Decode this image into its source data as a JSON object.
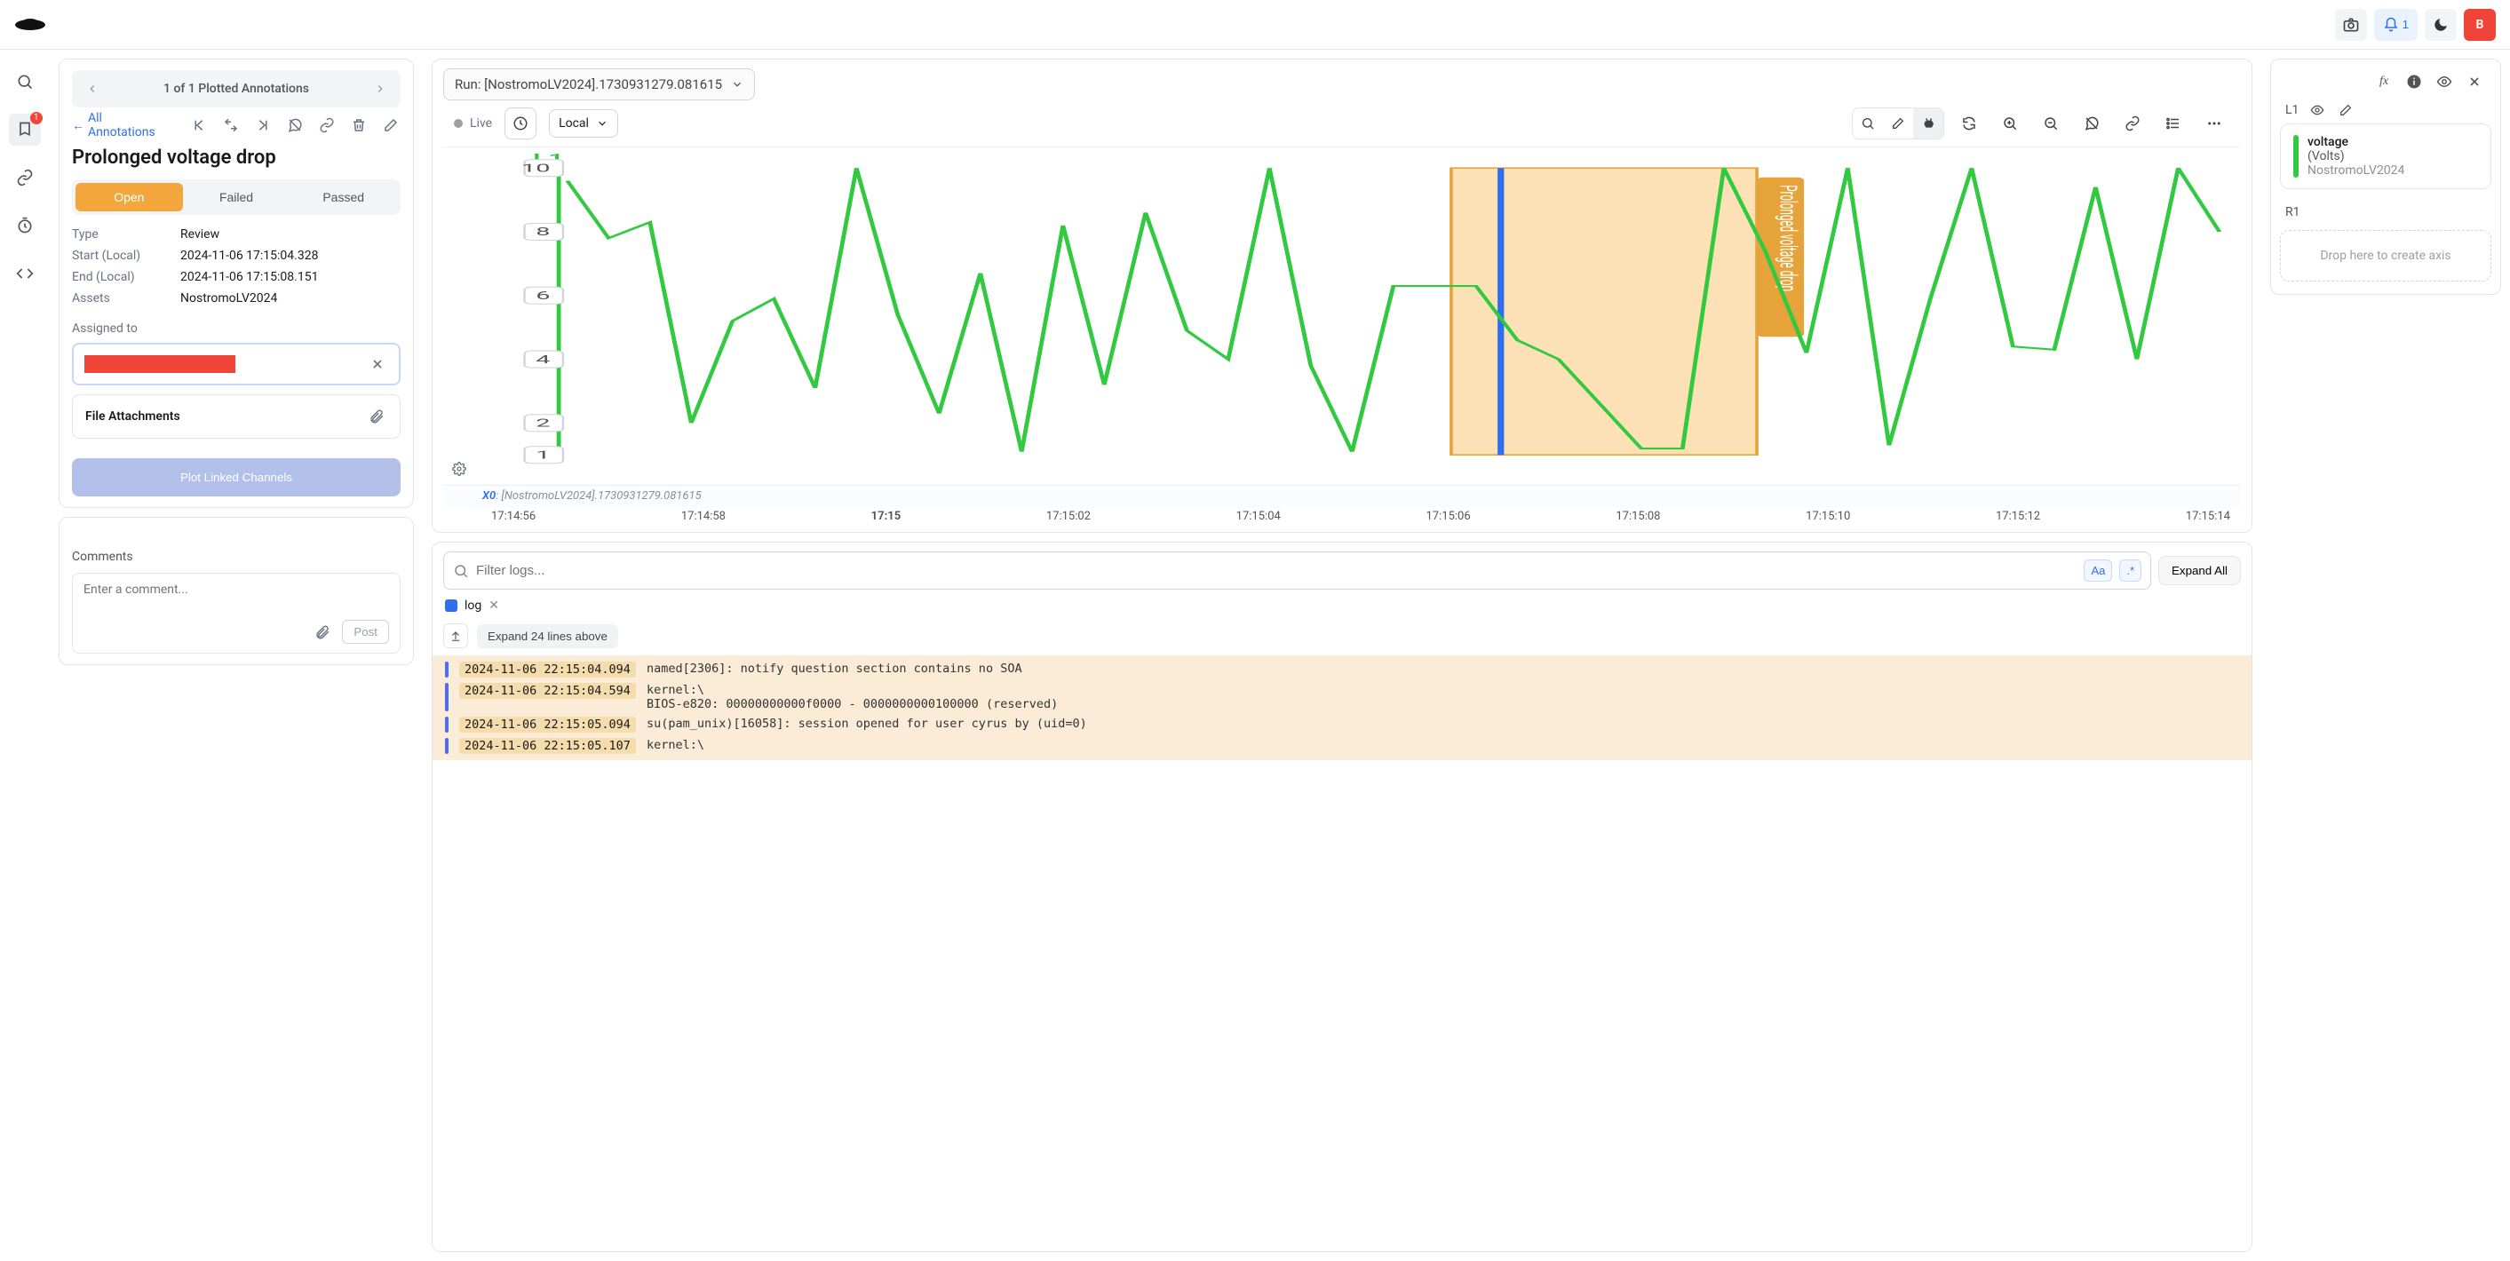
{
  "topbar": {
    "notif_count": "1",
    "avatar_initial": "B"
  },
  "railnav": {
    "badge": "1"
  },
  "left": {
    "pager_text": "1 of 1 Plotted Annotations",
    "back_link": "All Annotations",
    "title": "Prolonged voltage drop",
    "status": {
      "open": "Open",
      "failed": "Failed",
      "passed": "Passed"
    },
    "meta": {
      "type_k": "Type",
      "type_v": "Review",
      "start_k": "Start (Local)",
      "start_v": "2024-11-06 17:15:04.328",
      "end_k": "End (Local)",
      "end_v": "2024-11-06 17:15:08.151",
      "assets_k": "Assets",
      "assets_v": "NostromoLV2024"
    },
    "assigned_label": "Assigned to",
    "attachments_label": "File Attachments",
    "plot_btn": "Plot Linked Channels",
    "comments_label": "Comments",
    "comment_placeholder": "Enter a comment...",
    "post_btn": "Post"
  },
  "center": {
    "run_label": "Run: [NostromoLV2024].1730931279.081615",
    "live_label": "Live",
    "tz_label": "Local",
    "l1_label": "L1",
    "x0_label": "X0",
    "x0_run": ": [NostromoLV2024].1730931279.081615",
    "annotation_label": "Prolonged voltage drop",
    "xaxis_ticks": [
      "17:14:56",
      "17:14:58",
      "17:15",
      "17:15:02",
      "17:15:04",
      "17:15:06",
      "17:15:08",
      "17:15:10",
      "17:15:12",
      "17:15:14"
    ],
    "xaxis_bold_index": 2,
    "yticks": [
      "1",
      "2",
      "4",
      "6",
      "8",
      "10"
    ]
  },
  "chart_data": {
    "type": "line",
    "title": "",
    "xlabel": "",
    "ylabel": "",
    "ylim": [
      1,
      10
    ],
    "y_ticks": [
      1,
      2,
      4,
      6,
      8,
      10
    ],
    "x_ticks": [
      "17:14:56",
      "17:14:58",
      "17:15",
      "17:15:02",
      "17:15:04",
      "17:15:06",
      "17:15:08",
      "17:15:10",
      "17:15:12",
      "17:15:14"
    ],
    "series": [
      {
        "name": "voltage",
        "unit": "Volts",
        "asset": "NostromoLV2024",
        "color": "#31c940",
        "y": [
          9.6,
          7.8,
          8.3,
          2.0,
          5.2,
          5.9,
          3.1,
          10.0,
          5.4,
          2.3,
          6.7,
          1.1,
          8.2,
          3.2,
          8.6,
          4.9,
          4.0,
          10.0,
          3.8,
          1.1,
          6.3,
          6.3,
          6.3,
          4.6,
          4.0,
          2.6,
          1.2,
          1.2,
          10.0,
          7.4,
          4.2,
          10.0,
          1.3,
          5.9,
          10.0,
          4.4,
          4.3,
          9.4,
          4.0,
          10.0,
          8.0
        ]
      }
    ],
    "highlight_region": {
      "x_start": "17:15:04.328",
      "x_end": "17:15:08.151",
      "label": "Prolonged voltage drop"
    },
    "cursor_x": "17:15:05.0"
  },
  "logs": {
    "filter_placeholder": "Filter logs...",
    "case_toggle": "Aa",
    "regex_toggle": ".*",
    "expand_all": "Expand All",
    "chip_label": "log",
    "expand_above": "Expand 24 lines above",
    "lines": [
      {
        "ts": "2024-11-06 22:15:04.094",
        "msg": "named[2306]: notify question section contains no SOA"
      },
      {
        "ts": "2024-11-06 22:15:04.594",
        "msg": "kernel:\\\nBIOS-e820: 00000000000f0000 - 0000000000100000 (reserved)"
      },
      {
        "ts": "2024-11-06 22:15:05.094",
        "msg": "su(pam_unix)[16058]: session opened for user cyrus by (uid=0)"
      },
      {
        "ts": "2024-11-06 22:15:05.107",
        "msg": "kernel:\\"
      }
    ]
  },
  "right": {
    "l1_label": "L1",
    "r1_label": "R1",
    "channel": {
      "name": "voltage",
      "unit": "(Volts)",
      "asset": "NostromoLV2024"
    },
    "drop_text": "Drop here to create axis"
  }
}
